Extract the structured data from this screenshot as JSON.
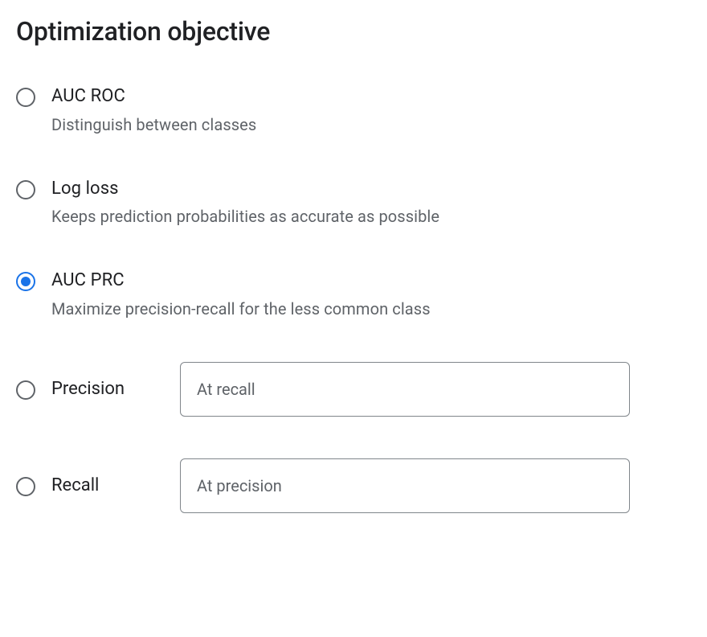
{
  "title": "Optimization objective",
  "options": {
    "auc_roc": {
      "label": "AUC ROC",
      "desc": "Distinguish between classes",
      "selected": false
    },
    "log_loss": {
      "label": "Log loss",
      "desc": "Keeps prediction probabilities as accurate as possible",
      "selected": false
    },
    "auc_prc": {
      "label": "AUC PRC",
      "desc": "Maximize precision-recall for the less common class",
      "selected": true
    },
    "precision": {
      "label": "Precision",
      "input_placeholder": "At recall",
      "input_value": "",
      "selected": false
    },
    "recall": {
      "label": "Recall",
      "input_placeholder": "At precision",
      "input_value": "",
      "selected": false
    }
  }
}
